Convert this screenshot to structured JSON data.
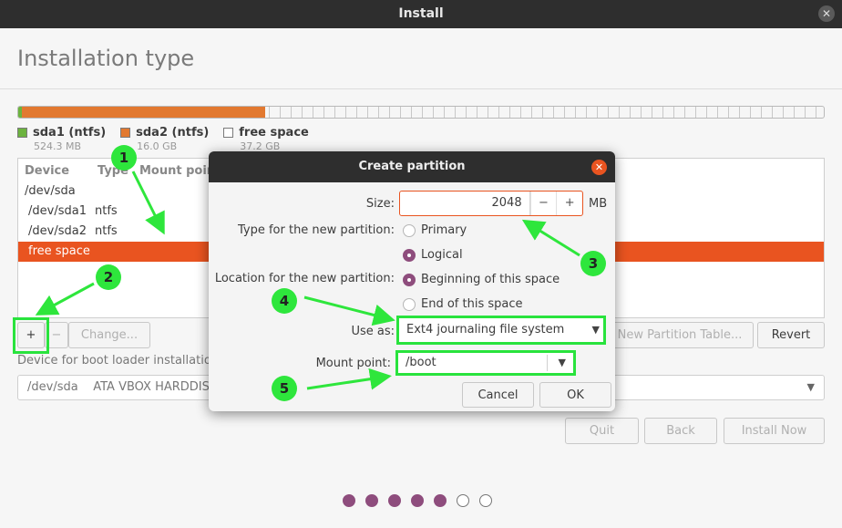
{
  "window": {
    "title": "Install",
    "close_glyph": "✕"
  },
  "page": {
    "title": "Installation type"
  },
  "partition_bar": {
    "colors": {
      "sda1": "#6cb33f",
      "sda2": "#e27930"
    }
  },
  "legend": [
    {
      "name": "sda1 (ntfs)",
      "size": "524.3 MB",
      "color": "#6cb33f"
    },
    {
      "name": "sda2 (ntfs)",
      "size": "16.0 GB",
      "color": "#e27930"
    },
    {
      "name": "free space",
      "size": "37.2 GB",
      "color": "#ffffff"
    }
  ],
  "table": {
    "headers": {
      "device": "Device",
      "type": "Type",
      "mount": "Mount point"
    },
    "rows": [
      {
        "device": "/dev/sda",
        "type": ""
      },
      {
        "device": "/dev/sda1",
        "type": "ntfs"
      },
      {
        "device": "/dev/sda2",
        "type": "ntfs"
      },
      {
        "device": "free space",
        "type": ""
      }
    ]
  },
  "buttons": {
    "add": "+",
    "remove": "−",
    "change": "Change...",
    "new_table": "New Partition Table...",
    "revert": "Revert",
    "quit": "Quit",
    "back": "Back",
    "install_now": "Install Now"
  },
  "boot_loader": {
    "label": "Device for boot loader installation:",
    "value": "/dev/sda    ATA VBOX HARDDISK"
  },
  "dialog": {
    "title": "Create partition",
    "size_label": "Size:",
    "size_value": "2048",
    "size_unit": "MB",
    "minus": "−",
    "plus": "+",
    "type_label": "Type for the new partition:",
    "type_primary": "Primary",
    "type_logical": "Logical",
    "location_label": "Location for the new partition:",
    "loc_beginning": "Beginning of this space",
    "loc_end": "End of this space",
    "use_as_label": "Use as:",
    "use_as_value": "Ext4 journaling file system",
    "mount_label": "Mount point:",
    "mount_value": "/boot",
    "cancel": "Cancel",
    "ok": "OK"
  },
  "progress_dots": {
    "filled": 5,
    "total": 7
  },
  "annotations": {
    "badges": [
      "1",
      "2",
      "3",
      "4",
      "5"
    ]
  }
}
